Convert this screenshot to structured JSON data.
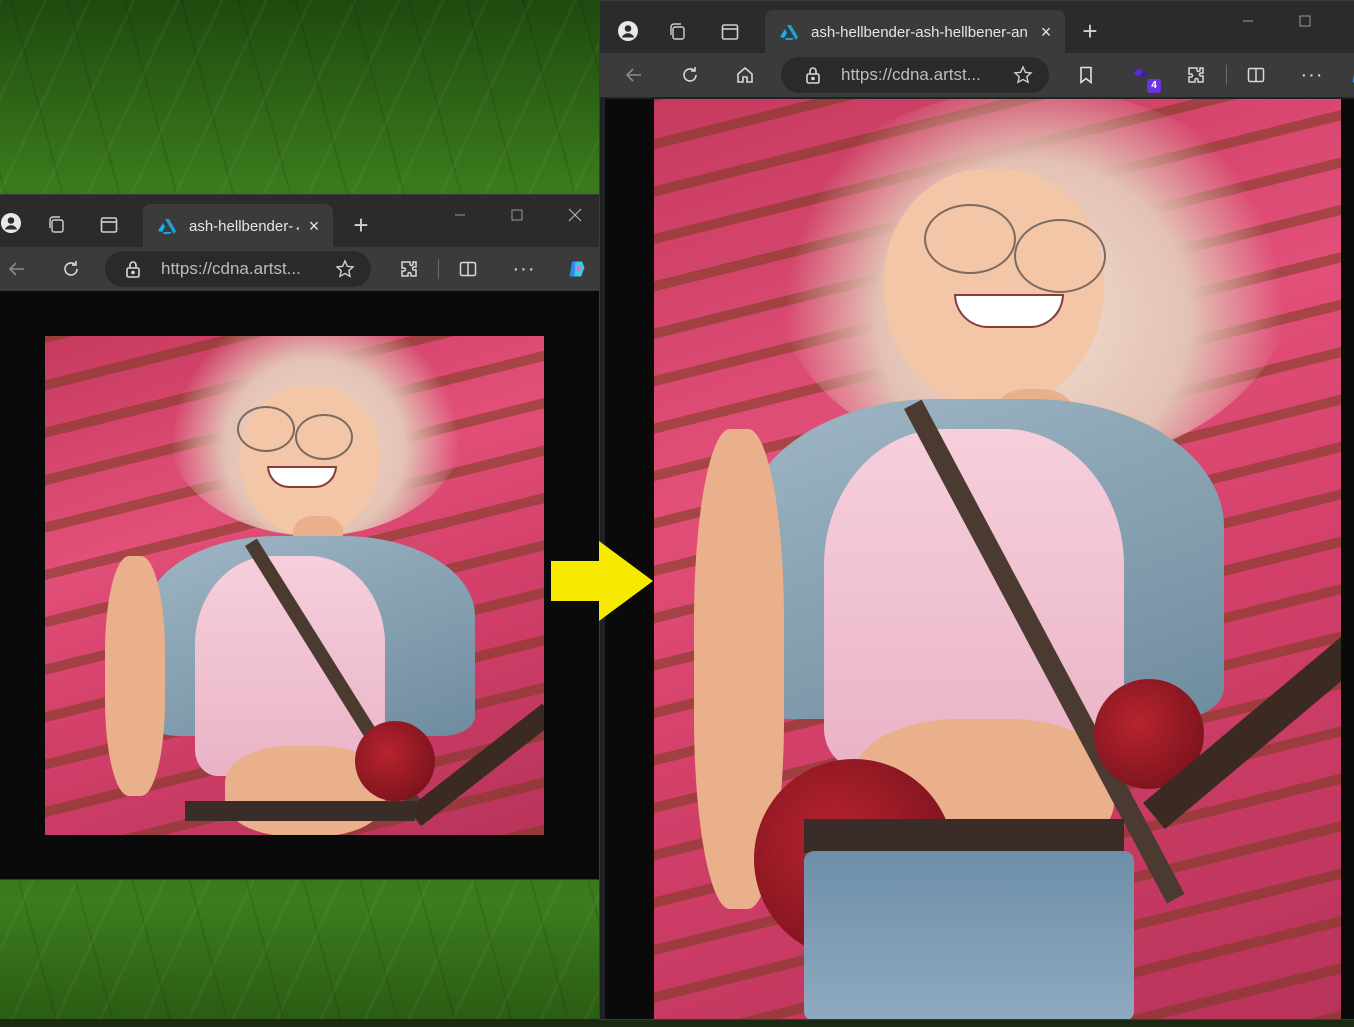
{
  "window_left": {
    "tab_title": "ash-hellbender-←",
    "url": "https://cdna.artst..."
  },
  "window_right": {
    "tab_title": "ash-hellbender-ash-hellbener-an",
    "url": "https://cdna.artst...",
    "extension_badge": "4"
  },
  "annotation": {
    "arrow_color": "#f5ea00"
  },
  "colors": {
    "tabstrip": "#2b2b2b",
    "toolbar": "#3b3b3b",
    "content_bg": "#0a0a0a"
  }
}
